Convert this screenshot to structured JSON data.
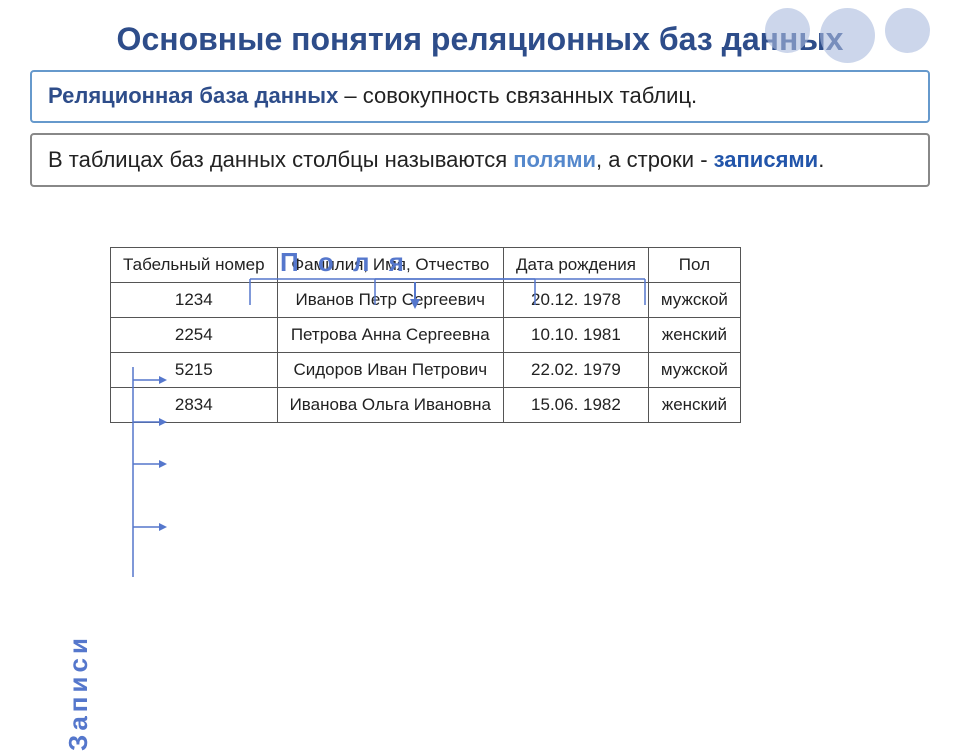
{
  "title": "Основные понятия реляционных баз данных",
  "definition": {
    "term": "Реляционная база данных",
    "rest": " – совокупность связанных таблиц."
  },
  "info_text_before": "В таблицах баз данных столбцы называются ",
  "info_field_word": "полями",
  "info_text_middle": ", а строки - ",
  "info_record_word": "записями",
  "info_text_end": ".",
  "polya_label": "П о л я",
  "zapisi_label": "Записи",
  "table": {
    "headers": [
      "Табельный номер",
      "Фамилия, Имя, Отчество",
      "Дата рождения",
      "Пол"
    ],
    "rows": [
      [
        "1234",
        "Иванов Петр Сергеевич",
        "20.12. 1978",
        "мужской"
      ],
      [
        "2254",
        "Петрова Анна Сергеевна",
        "10.10. 1981",
        "женский"
      ],
      [
        "5215",
        "Сидоров Иван Петрович",
        "22.02. 1979",
        "мужской"
      ],
      [
        "2834",
        "Иванова Ольга Ивановна",
        "15.06. 1982",
        "женский"
      ]
    ]
  }
}
